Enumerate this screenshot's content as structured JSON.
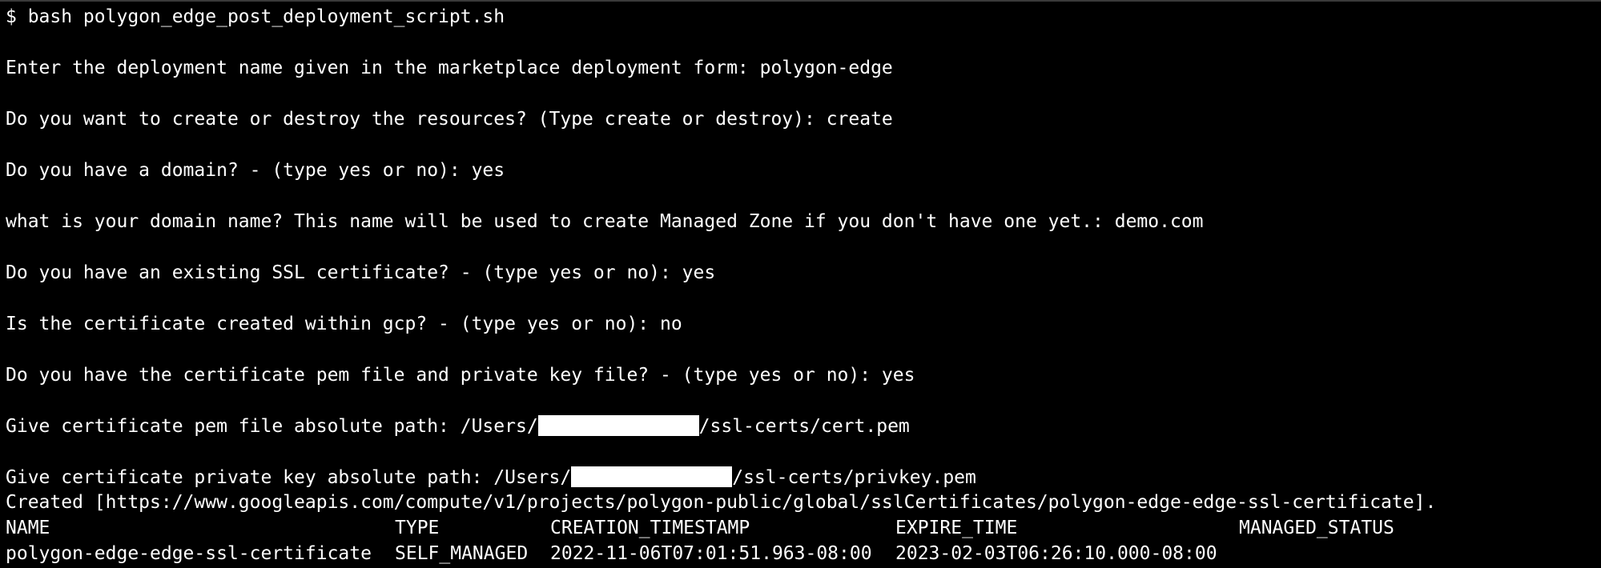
{
  "colors": {
    "background": "#000000",
    "text": "#ffffff",
    "redaction": "#ffffff"
  },
  "terminal": {
    "command": "$ bash polygon_edge_post_deployment_script.sh",
    "prompts": [
      "Enter the deployment name given in the marketplace deployment form: polygon-edge",
      "Do you want to create or destroy the resources? (Type create or destroy): create",
      "Do you have a domain? - (type yes or no): yes",
      "what is your domain name? This name will be used to create Managed Zone if you don't have one yet.: demo.com",
      "Do you have an existing SSL certificate? - (type yes or no): yes",
      "Is the certificate created within gcp? - (type yes or no): no",
      "Do you have the certificate pem file and private key file? - (type yes or no): yes"
    ],
    "pem_path": {
      "prefix": "Give certificate pem file absolute path: /Users/",
      "suffix": "/ssl-certs/cert.pem"
    },
    "key_path": {
      "prefix": "Give certificate private key absolute path: /Users/",
      "suffix": "/ssl-certs/privkey.pem"
    },
    "created": "Created [https://www.googleapis.com/compute/v1/projects/polygon-public/global/sslCertificates/polygon-edge-edge-ssl-certificate].",
    "table": {
      "headers": [
        "NAME",
        "TYPE",
        "CREATION_TIMESTAMP",
        "EXPIRE_TIME",
        "MANAGED_STATUS"
      ],
      "row": [
        "polygon-edge-edge-ssl-certificate",
        "SELF_MANAGED",
        "2022-11-06T07:01:51.963-08:00",
        "2023-02-03T06:26:10.000-08:00",
        ""
      ]
    }
  }
}
